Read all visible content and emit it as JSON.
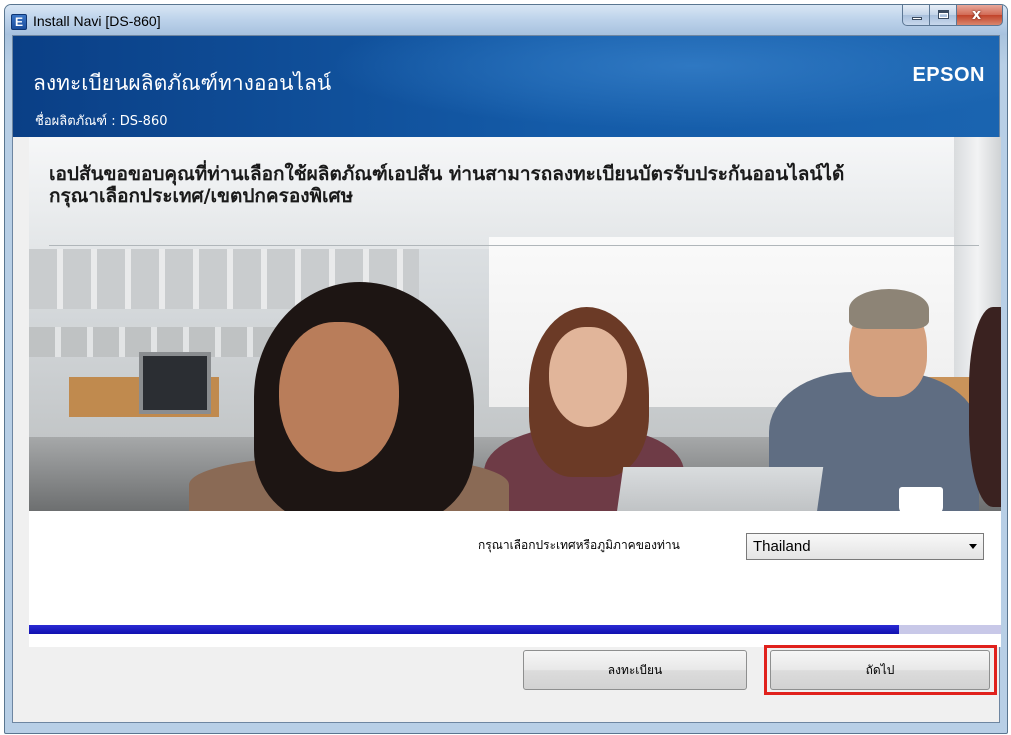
{
  "window": {
    "title": "Install Navi [DS-860]",
    "icon": "E",
    "icon_name": "epson-app-icon",
    "close_glyph": "x"
  },
  "header": {
    "title": "ลงทะเบียนผลิตภัณฑ์ทางออนไลน์",
    "brand": "EPSON",
    "product_name": "ชื่อผลิตภัณฑ์ : DS-860"
  },
  "banner": {
    "line1": "เอปสันขอขอบคุณที่ท่านเลือกใช้ผลิตภัณฑ์เอปสัน ท่านสามารถลงทะเบียนบัตรรับประกันออนไลน์ได้",
    "line2": "กรุณาเลือกประเทศ/เขตปกครองพิเศษ"
  },
  "country": {
    "label": "กรุณาเลือกประเทศหรือภูมิภาคของท่าน",
    "selected": "Thailand"
  },
  "progress": {
    "fraction": 0.895
  },
  "buttons": {
    "register": "ลงทะเบียน",
    "next": "ถัดไป"
  },
  "colors": {
    "header_blue": "#145ba8",
    "progress_blue": "#1a1ac4",
    "highlight_red": "#e0211c"
  }
}
